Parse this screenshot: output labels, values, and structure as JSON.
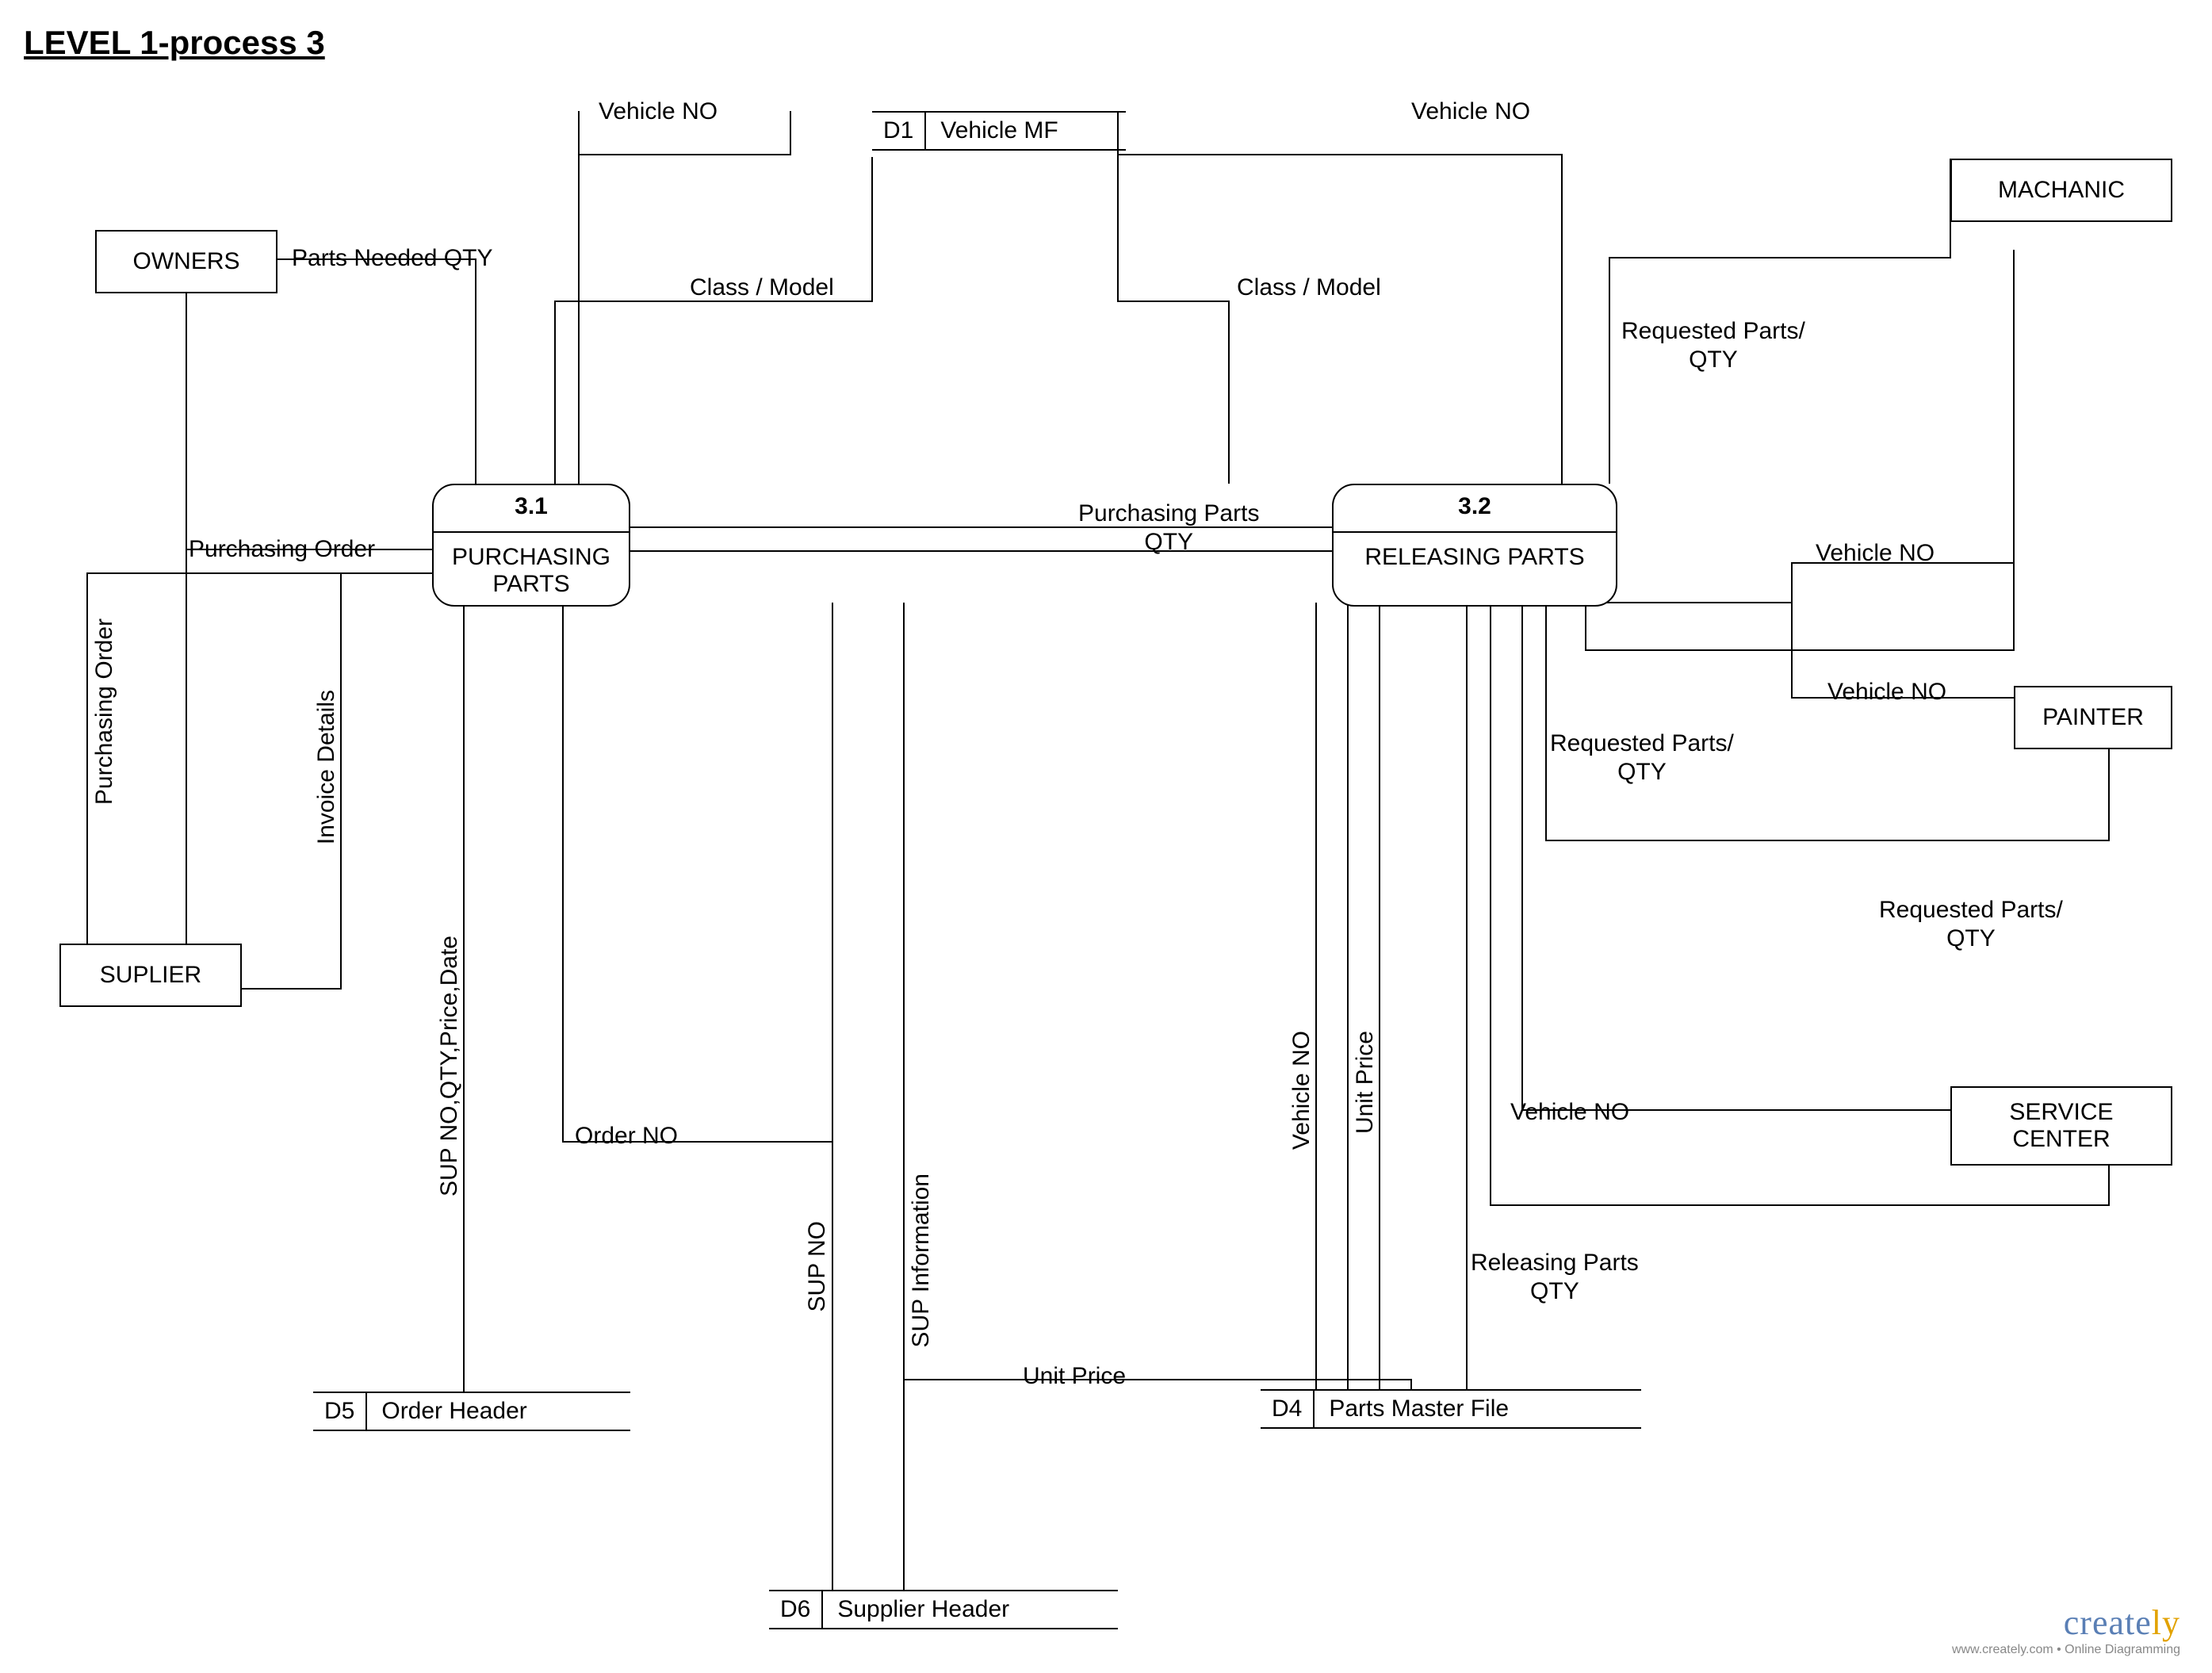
{
  "title": "LEVEL 1-process 3",
  "entities": {
    "owners": "OWNERS",
    "suplier": "SUPLIER",
    "machanic": "MACHANIC",
    "painter": "PAINTER",
    "service_center": "SERVICE\nCENTER"
  },
  "processes": {
    "p31": {
      "id": "3.1",
      "name": "PURCHASING PARTS"
    },
    "p32": {
      "id": "3.2",
      "name": "RELEASING PARTS"
    }
  },
  "datastores": {
    "d1": {
      "id": "D1",
      "name": "Vehicle MF"
    },
    "d5": {
      "id": "D5",
      "name": "Order Header"
    },
    "d6": {
      "id": "D6",
      "name": "Supplier Header"
    },
    "d4": {
      "id": "D4",
      "name": "Parts Master File"
    }
  },
  "labels": {
    "vehicle_no_left": "Vehicle NO",
    "vehicle_no_right": "Vehicle NO",
    "parts_needed_qty": "Parts Needed QTY",
    "class_model_left": "Class / Model",
    "class_model_right": "Class / Model",
    "requested_parts_qty_1": "Requested Parts/\nQTY",
    "requested_parts_qty_2": "Requested Parts/\nQTY",
    "requested_parts_qty_3": "Requested Parts/\nQTY",
    "purchasing_order_h": "Purchasing Order",
    "purchasing_order_v": "Purchasing Order",
    "invoice_details": "Invoice Details",
    "sup_no_qty_price_date": "SUP NO,QTY,Price,Date",
    "order_no": "Order NO",
    "sup_no": "SUP NO",
    "sup_information": "SUP Information",
    "unit_price_h": "Unit Price",
    "unit_price_v": "Unit Price",
    "vehicle_no_v": "Vehicle NO",
    "releasing_parts_qty": "Releasing Parts\nQTY",
    "purchasing_parts_qty": "Purchasing Parts\nQTY",
    "vehicle_no_mach": "Vehicle NO",
    "vehicle_no_paint": "Vehicle NO",
    "vehicle_no_svc": "Vehicle NO"
  },
  "logo": {
    "c": "create",
    "ly": "ly",
    "tag": "www.creately.com • Online Diagramming"
  }
}
